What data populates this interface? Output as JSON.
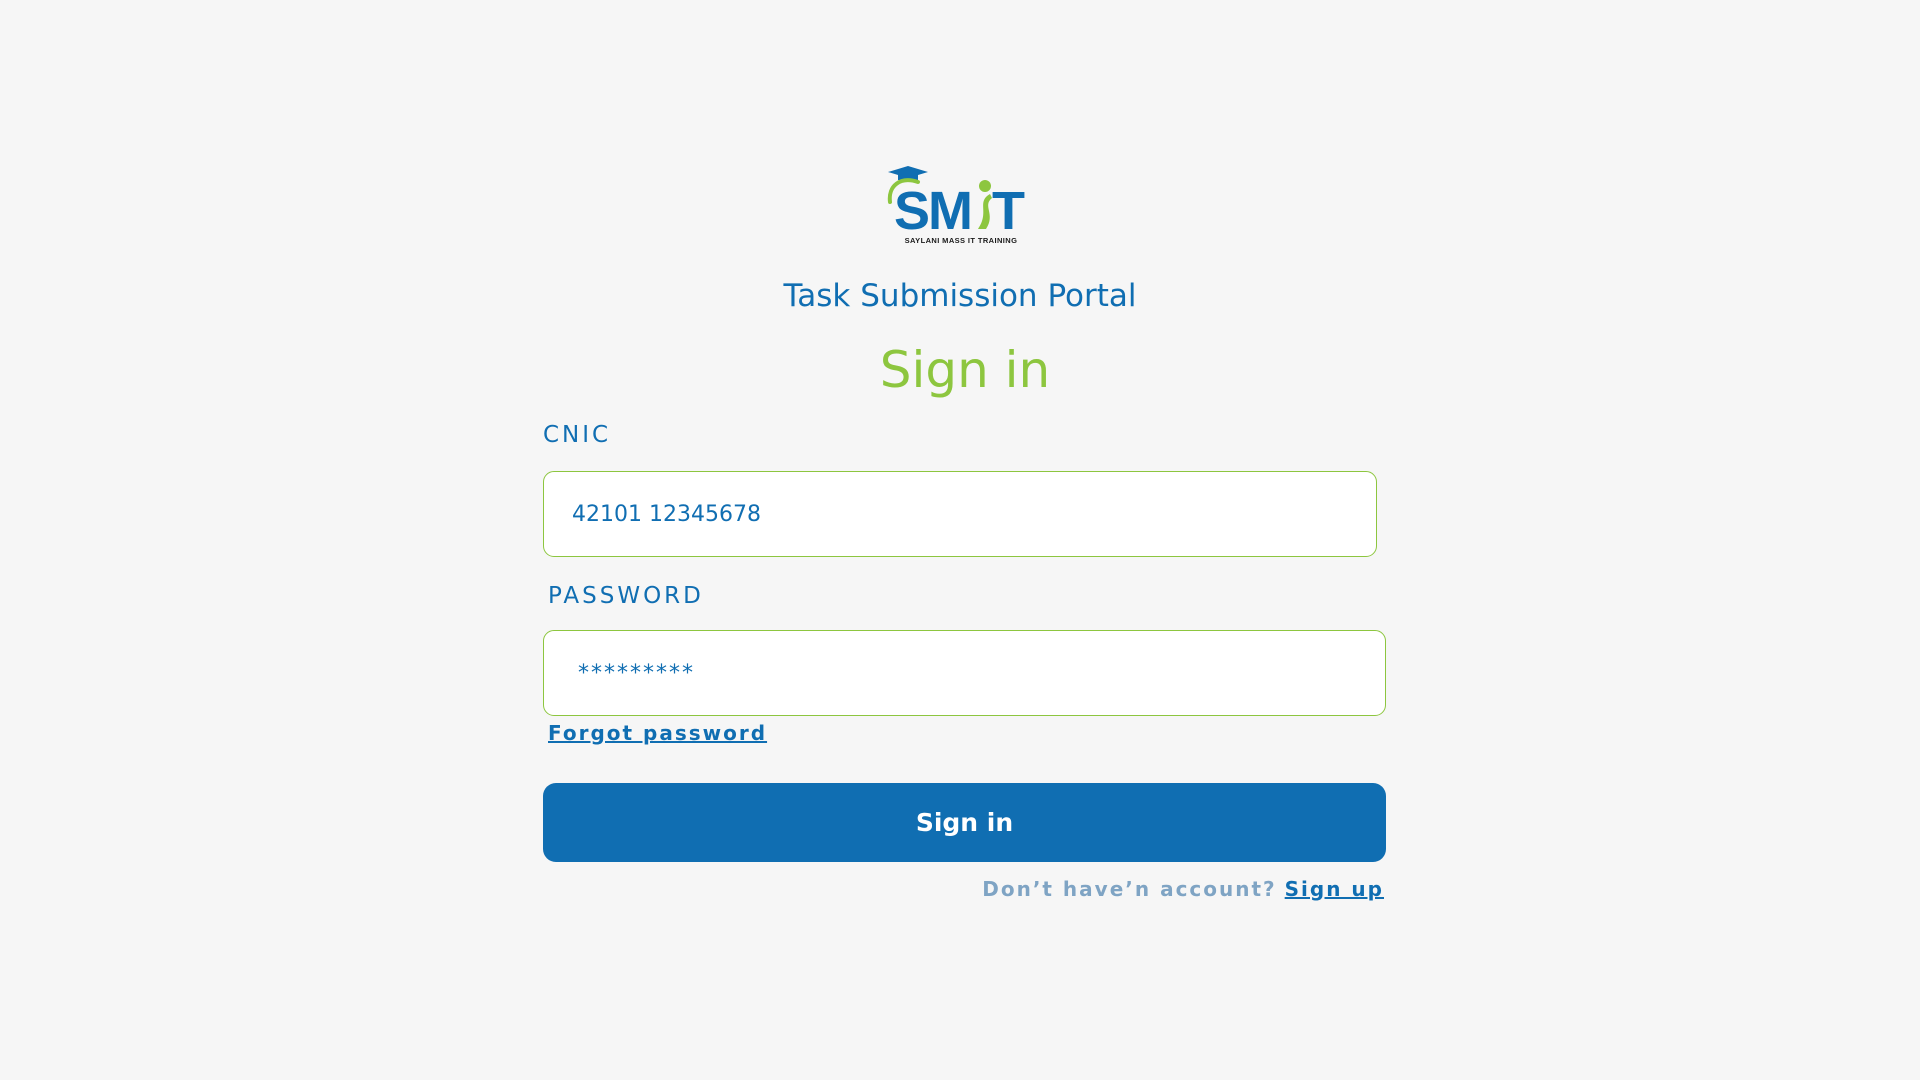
{
  "brand": {
    "logo_text": "SMIT",
    "logo_tagline": "SAYLANI MASS IT TRAINING",
    "primary_color": "#106eb2",
    "accent_color": "#8dc63f"
  },
  "header": {
    "portal_title": "Task Submission Portal",
    "signin_heading": "Sign in"
  },
  "form": {
    "cnic_label": "CNIC",
    "cnic_value": "42101 12345678",
    "password_label": "PASSWORD",
    "password_value": "*********",
    "forgot_password": "Forgot password",
    "submit_label": "Sign in"
  },
  "footer": {
    "no_account_text": "Don’t have’n account?",
    "signup_link": "Sign up"
  }
}
